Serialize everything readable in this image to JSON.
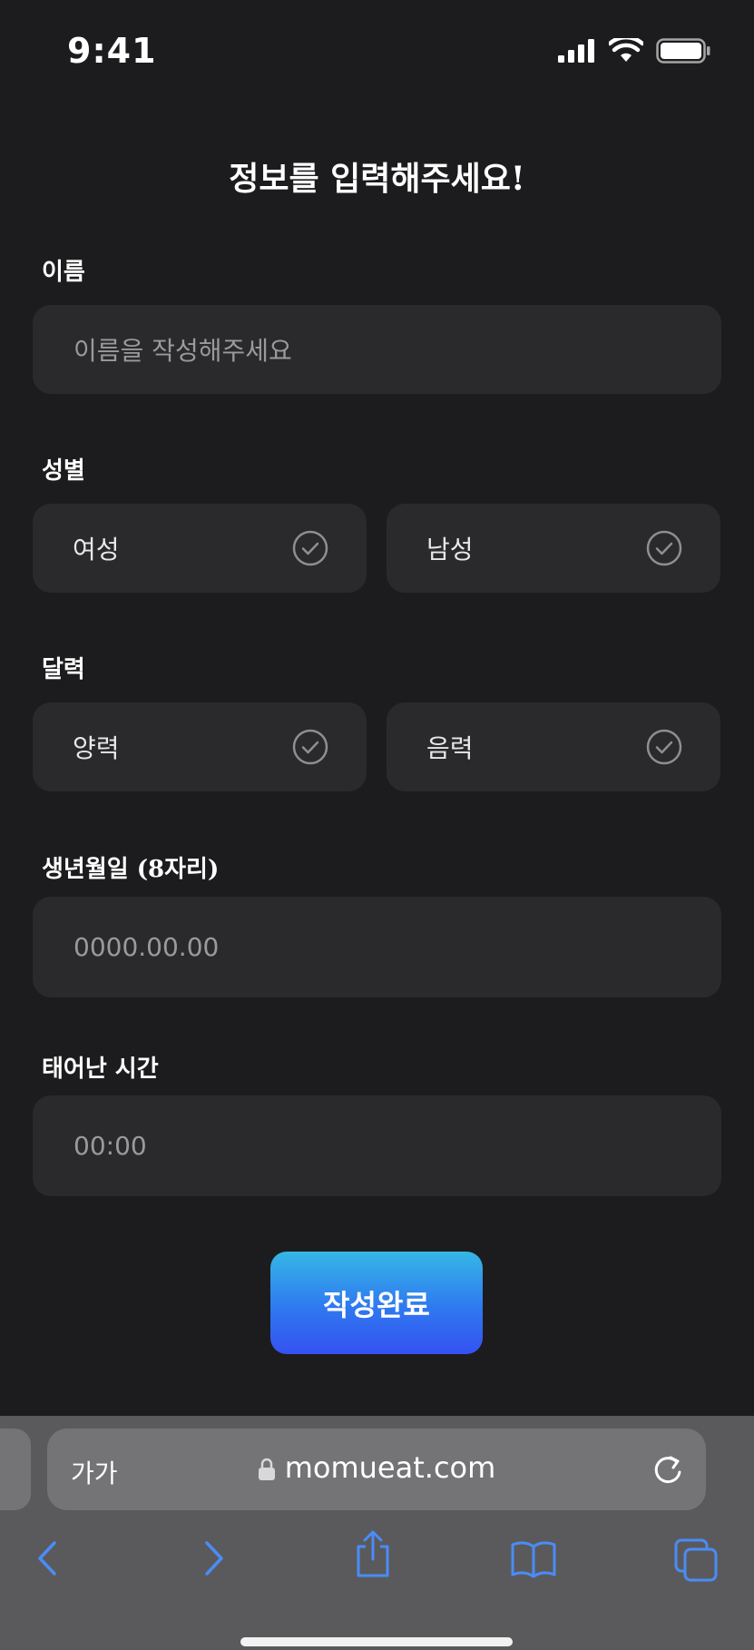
{
  "status": {
    "time": "9:41"
  },
  "page": {
    "title": "정보를 입력해주세요!"
  },
  "name_section": {
    "label": "이름",
    "placeholder": "이름을 작성해주세요"
  },
  "gender_section": {
    "label": "성별",
    "options": [
      "여성",
      "남성"
    ]
  },
  "calendar_section": {
    "label": "달력",
    "options": [
      "양력",
      "음력"
    ]
  },
  "birthdate_section": {
    "label": "생년월일 (8자리)",
    "placeholder": "0000.00.00"
  },
  "birthtime_section": {
    "label": "태어난 시간",
    "placeholder": "00:00"
  },
  "submit": {
    "label": "작성완료"
  },
  "browser": {
    "text_size_label": "가가",
    "url": "momueat.com"
  },
  "colors": {
    "background": "#1c1c1e",
    "field": "#2a2a2c",
    "accent_start": "#35b7e6",
    "accent_end": "#3552f2",
    "toolbar_icon": "#4a8cf7"
  },
  "icons": [
    "signal-icon",
    "wifi-icon",
    "battery-icon",
    "check-circle-icon",
    "lock-icon",
    "reload-icon",
    "back-icon",
    "forward-icon",
    "share-icon",
    "bookmarks-icon",
    "tabs-icon"
  ]
}
